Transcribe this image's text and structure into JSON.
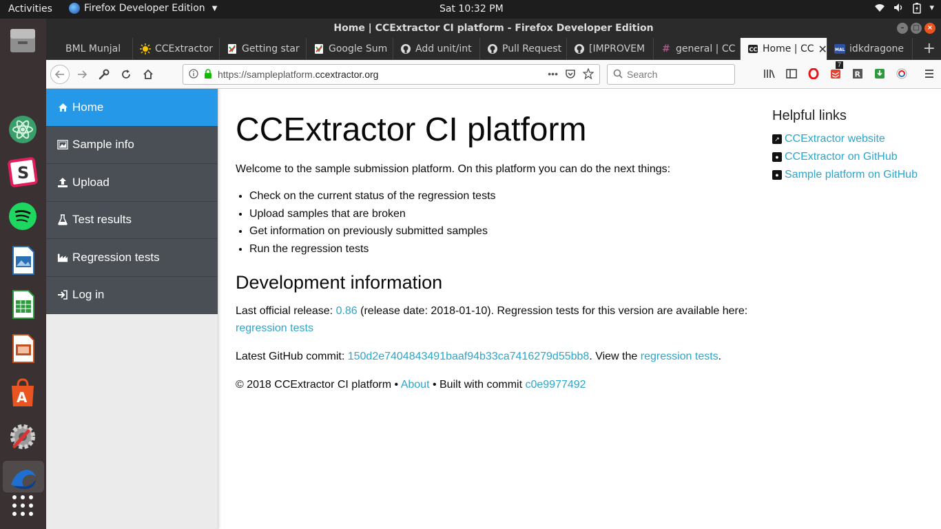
{
  "topbar": {
    "activities": "Activities",
    "app_name": "Firefox Developer Edition",
    "clock": "Sat 10:32 PM"
  },
  "window": {
    "title": "Home | CCExtractor CI platform - Firefox Developer Edition"
  },
  "tabs": [
    {
      "label": "BML Munjal",
      "icon": "globe-icon"
    },
    {
      "label": "CCExtractor",
      "icon": "sun-icon"
    },
    {
      "label": "Getting star",
      "icon": "google-sheets-icon"
    },
    {
      "label": "Google Sum",
      "icon": "google-sheets-icon"
    },
    {
      "label": "Add unit/int",
      "icon": "github-icon"
    },
    {
      "label": "Pull Request",
      "icon": "github-icon"
    },
    {
      "label": "[IMPROVEM",
      "icon": "github-icon"
    },
    {
      "label": "general | CC",
      "icon": "slack-icon"
    },
    {
      "label": "Home | CC",
      "icon": "cc-icon"
    },
    {
      "label": "idkdragone",
      "icon": "mal-icon"
    }
  ],
  "navbar": {
    "url_prefix": "https://sampleplatform.",
    "url_host": "ccextractor.org",
    "search_placeholder": "Search",
    "badge": "7"
  },
  "sidenav": {
    "items": [
      {
        "label": "Home",
        "icon": "home-icon",
        "active": true
      },
      {
        "label": "Sample info",
        "icon": "image-icon",
        "active": false
      },
      {
        "label": "Upload",
        "icon": "upload-icon",
        "active": false
      },
      {
        "label": "Test results",
        "icon": "flask-icon",
        "active": false
      },
      {
        "label": "Regression tests",
        "icon": "factory-icon",
        "active": false
      },
      {
        "label": "Log in",
        "icon": "sign-in-icon",
        "active": false
      }
    ]
  },
  "main": {
    "title": "CCExtractor CI platform",
    "intro": "Welcome to the sample submission platform. On this platform you can do the next things:",
    "features": [
      "Check on the current status of the regression tests",
      "Upload samples that are broken",
      "Get information on previously submitted samples",
      "Run the regression tests"
    ],
    "dev_heading": "Development information",
    "release_prefix": "Last official release: ",
    "release_version": "0.86",
    "release_suffix": " (release date: 2018-01-10). Regression tests for this version are available here: ",
    "release_link": "regression tests",
    "commit_prefix": "Latest GitHub commit: ",
    "commit_hash": "150d2e7404843491baaf94b33ca7416279d55bb8",
    "commit_mid": ". View the ",
    "commit_link": "regression tests",
    "commit_suffix": ".",
    "footer_prefix": "© 2018 CCExtractor CI platform • ",
    "footer_about": "About",
    "footer_mid": " • Built with commit ",
    "footer_commit": "c0e9977492"
  },
  "helpful": {
    "heading": "Helpful links",
    "links": [
      {
        "label": "CCExtractor website",
        "icon": "external-link-icon"
      },
      {
        "label": "CCExtractor on GitHub",
        "icon": "github-icon"
      },
      {
        "label": "Sample platform on GitHub",
        "icon": "github-icon"
      }
    ]
  },
  "colors": {
    "accent": "#2599e8",
    "link": "#2ba6cb",
    "sidenav_bg": "#4a4f55"
  }
}
